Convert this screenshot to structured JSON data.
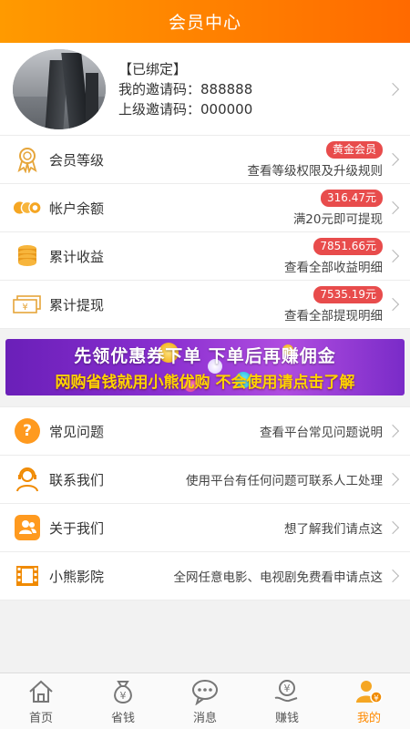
{
  "header": {
    "title": "会员中心"
  },
  "profile": {
    "bound": "【已绑定】",
    "invite_code": "我的邀请码：888888",
    "parent_code": "上级邀请码：000000"
  },
  "stats": [
    {
      "label": "会员等级",
      "badge": "黄金会员",
      "sub": "查看等级权限及升级规则",
      "icon": "medal-icon"
    },
    {
      "label": "帐户余额",
      "badge": "316.47元",
      "sub": "满20元即可提现",
      "icon": "coins-icon"
    },
    {
      "label": "累计收益",
      "badge": "7851.66元",
      "sub": "查看全部收益明细",
      "icon": "coin-stack-icon"
    },
    {
      "label": "累计提现",
      "badge": "7535.19元",
      "sub": "查看全部提现明细",
      "icon": "cash-icon"
    }
  ],
  "banner": {
    "line1": "先领优惠券下单 下单后再赚佣金",
    "line2": "网购省钱就用小熊优购 不会使用请点击了解"
  },
  "menu": [
    {
      "label": "常见问题",
      "desc": "查看平台常见问题说明",
      "icon": "question-icon"
    },
    {
      "label": "联系我们",
      "desc": "使用平台有任何问题可联系人工处理",
      "icon": "support-agent-icon"
    },
    {
      "label": "关于我们",
      "desc": "想了解我们请点这",
      "icon": "people-icon"
    },
    {
      "label": "小熊影院",
      "desc": "全网任意电影、电视剧免费看申请点这",
      "icon": "film-icon"
    }
  ],
  "tabs": [
    {
      "label": "首页",
      "icon": "home-icon"
    },
    {
      "label": "省钱",
      "icon": "money-bag-icon"
    },
    {
      "label": "消息",
      "icon": "chat-icon"
    },
    {
      "label": "赚钱",
      "icon": "yen-hand-icon"
    },
    {
      "label": "我的",
      "icon": "user-yen-icon",
      "active": true
    }
  ],
  "colors": {
    "accent": "#ff8a00",
    "badge": "#e84c4c",
    "header_start": "#ff9a00",
    "header_end": "#ff6a00"
  }
}
